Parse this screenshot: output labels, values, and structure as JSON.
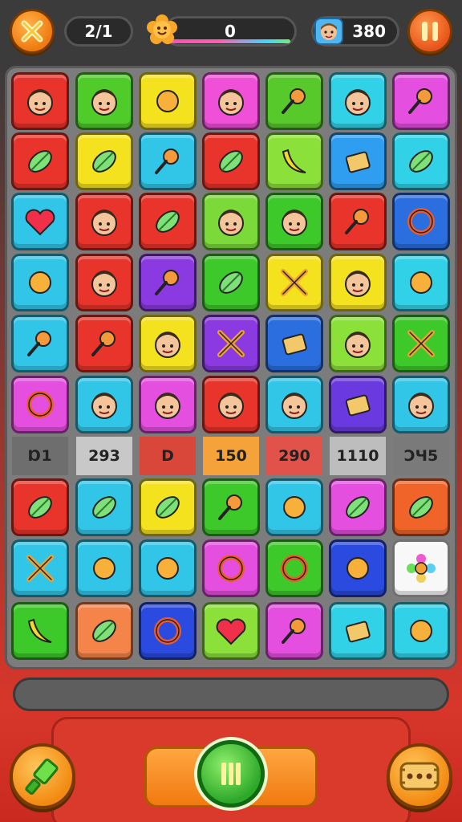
{
  "hud": {
    "close_icon": "close-x-icon",
    "moves": "2/1",
    "score_icon": "flower-face-icon",
    "score": "0",
    "player_icon": "player-face-icon",
    "coins": "380",
    "pause_icon": "pause-icon"
  },
  "board": {
    "tiles": [
      {
        "row": 0,
        "col": 0,
        "color": "#e8342a",
        "icon": "boy-face-icon"
      },
      {
        "row": 0,
        "col": 1,
        "color": "#4fcb2a",
        "icon": "cat-face-icon"
      },
      {
        "row": 0,
        "col": 2,
        "color": "#f5e21f",
        "icon": "cupcake-icon"
      },
      {
        "row": 0,
        "col": 3,
        "color": "#f04fd8",
        "icon": "green-elf-face-icon"
      },
      {
        "row": 0,
        "col": 4,
        "color": "#58c92a",
        "icon": "candy-drop-icon"
      },
      {
        "row": 0,
        "col": 5,
        "color": "#31d2e8",
        "icon": "girl-face-icon"
      },
      {
        "row": 0,
        "col": 6,
        "color": "#e54fe0",
        "icon": "lollipop-icon"
      },
      {
        "row": 1,
        "col": 0,
        "color": "#e8342a",
        "icon": "blue-capsule-icon"
      },
      {
        "row": 1,
        "col": 1,
        "color": "#f5e21f",
        "icon": "green-leaf-icon"
      },
      {
        "row": 1,
        "col": 2,
        "color": "#31c6e8",
        "icon": "green-lollipop-icon"
      },
      {
        "row": 1,
        "col": 3,
        "color": "#e8342a",
        "icon": "striped-candy-icon"
      },
      {
        "row": 1,
        "col": 4,
        "color": "#8be03a",
        "icon": "banana-icon"
      },
      {
        "row": 1,
        "col": 5,
        "color": "#2f9ef0",
        "icon": "blue-box-icon"
      },
      {
        "row": 1,
        "col": 6,
        "color": "#31d2e8",
        "icon": "bone-candy-icon"
      },
      {
        "row": 2,
        "col": 0,
        "color": "#31c6e8",
        "icon": "heart-check-icon"
      },
      {
        "row": 2,
        "col": 1,
        "color": "#e8342a",
        "icon": "boy-face-icon"
      },
      {
        "row": 2,
        "col": 2,
        "color": "#e8342a",
        "icon": "pink-candy-icon"
      },
      {
        "row": 2,
        "col": 3,
        "color": "#7bd93a",
        "icon": "boy-face-icon"
      },
      {
        "row": 2,
        "col": 4,
        "color": "#3ec92a",
        "icon": "pale-face-icon"
      },
      {
        "row": 2,
        "col": 5,
        "color": "#e8342a",
        "icon": "carrot-icon"
      },
      {
        "row": 2,
        "col": 6,
        "color": "#2a6ee0",
        "icon": "swirl-icon"
      },
      {
        "row": 3,
        "col": 0,
        "color": "#31c6e8",
        "icon": "glue-bottle-icon"
      },
      {
        "row": 3,
        "col": 1,
        "color": "#e8342a",
        "icon": "grandpa-face-icon"
      },
      {
        "row": 3,
        "col": 2,
        "color": "#8a3ae0",
        "icon": "wand-icon"
      },
      {
        "row": 3,
        "col": 3,
        "color": "#3ec92a",
        "icon": "shell-candy-icon"
      },
      {
        "row": 3,
        "col": 4,
        "color": "#f5e21f",
        "icon": "crossed-sticks-icon"
      },
      {
        "row": 3,
        "col": 5,
        "color": "#f5e21f",
        "icon": "purple-monster-icon"
      },
      {
        "row": 3,
        "col": 6,
        "color": "#31d2e8",
        "icon": "purple-ice-pop-icon"
      },
      {
        "row": 4,
        "col": 0,
        "color": "#31c6e8",
        "icon": "orange-drop-icon"
      },
      {
        "row": 4,
        "col": 1,
        "color": "#e8342a",
        "icon": "brush-icon"
      },
      {
        "row": 4,
        "col": 2,
        "color": "#f5e21f",
        "icon": "purple-face-icon"
      },
      {
        "row": 4,
        "col": 3,
        "color": "#8a3ae0",
        "icon": "blue-cross-icon"
      },
      {
        "row": 4,
        "col": 4,
        "color": "#2a6ee0",
        "icon": "yellow-bar-icon"
      },
      {
        "row": 4,
        "col": 5,
        "color": "#8be03a",
        "icon": "girl-face-icon"
      },
      {
        "row": 4,
        "col": 6,
        "color": "#3ec92a",
        "icon": "crossed-sticks-icon"
      },
      {
        "row": 5,
        "col": 0,
        "color": "#e54fe0",
        "icon": "flower-ring-icon"
      },
      {
        "row": 5,
        "col": 1,
        "color": "#31c6e8",
        "icon": "orange-face-icon"
      },
      {
        "row": 5,
        "col": 2,
        "color": "#e54fe0",
        "icon": "sun-face-icon"
      },
      {
        "row": 5,
        "col": 3,
        "color": "#e8342a",
        "icon": "pink-hair-face-icon"
      },
      {
        "row": 5,
        "col": 4,
        "color": "#31c6e8",
        "icon": "green-lion-icon"
      },
      {
        "row": 5,
        "col": 5,
        "color": "#6a3ae0",
        "icon": "cheese-icon"
      },
      {
        "row": 5,
        "col": 6,
        "color": "#31c6e8",
        "icon": "girl-face-icon"
      },
      {
        "row": 7,
        "col": 0,
        "color": "#e8342a",
        "icon": "striped-melon-icon"
      },
      {
        "row": 7,
        "col": 1,
        "color": "#31c6e8",
        "icon": "green-leaf-icon"
      },
      {
        "row": 7,
        "col": 2,
        "color": "#f5e21f",
        "icon": "purple-candy-icon"
      },
      {
        "row": 7,
        "col": 3,
        "color": "#3ec92a",
        "icon": "blue-balloon-icon"
      },
      {
        "row": 7,
        "col": 4,
        "color": "#31c6e8",
        "icon": "orange-bubble-icon"
      },
      {
        "row": 7,
        "col": 5,
        "color": "#e54fe0",
        "icon": "blue-leaf-icon"
      },
      {
        "row": 7,
        "col": 6,
        "color": "#f0642a",
        "icon": "striped-melon-icon"
      },
      {
        "row": 8,
        "col": 0,
        "color": "#31c6e8",
        "icon": "crossed-sticks-icon"
      },
      {
        "row": 8,
        "col": 1,
        "color": "#31c6e8",
        "icon": "green-blob-icon"
      },
      {
        "row": 8,
        "col": 2,
        "color": "#31c6e8",
        "icon": "yellow-sun-icon"
      },
      {
        "row": 8,
        "col": 3,
        "color": "#e54fe0",
        "icon": "orange-ring-icon"
      },
      {
        "row": 8,
        "col": 4,
        "color": "#3ec92a",
        "icon": "target-icon"
      },
      {
        "row": 8,
        "col": 5,
        "color": "#2a4ae0",
        "icon": "pink-umbrella-icon"
      },
      {
        "row": 8,
        "col": 6,
        "color": "#f8f8f8",
        "icon": "rainbow-flower-icon"
      },
      {
        "row": 9,
        "col": 0,
        "color": "#3ec92a",
        "icon": "banana-icon"
      },
      {
        "row": 9,
        "col": 1,
        "color": "#f5844a",
        "icon": "yellow-leaf-icon"
      },
      {
        "row": 9,
        "col": 2,
        "color": "#2a4ae0",
        "icon": "blue-swirl-icon"
      },
      {
        "row": 9,
        "col": 3,
        "color": "#8be03a",
        "icon": "heart-icon"
      },
      {
        "row": 9,
        "col": 4,
        "color": "#e54fe0",
        "icon": "green-lollipop-icon"
      },
      {
        "row": 9,
        "col": 5,
        "color": "#31d2e8",
        "icon": "green-cube-icon"
      },
      {
        "row": 9,
        "col": 6,
        "color": "#31d2e8",
        "icon": "yellow-bone-icon"
      }
    ],
    "score_row": [
      {
        "label": "Ɒ1",
        "color": "#6e6e6e"
      },
      {
        "label": "293",
        "color": "#c8c8c8"
      },
      {
        "label": "D",
        "color": "#d9463a"
      },
      {
        "label": "150",
        "color": "#f5a23a"
      },
      {
        "label": "290",
        "color": "#e0524a"
      },
      {
        "label": "1110",
        "color": "#bdbdbd"
      },
      {
        "label": "ƆЧ5",
        "color": "#7a7a7a"
      }
    ]
  },
  "footer": {
    "left_icon": "green-brush-icon",
    "center_icon": "pause-icon",
    "right_icon": "cookie-icon"
  }
}
